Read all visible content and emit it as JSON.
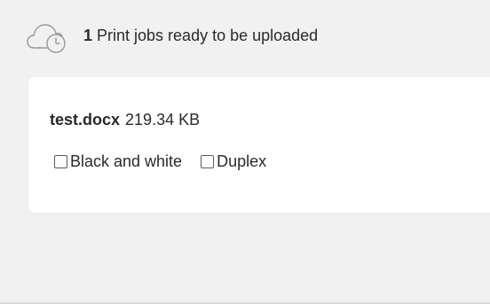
{
  "header": {
    "count": "1",
    "text": "Print jobs ready to be uploaded",
    "icon": "cloud-clock-icon"
  },
  "job": {
    "file_name": "test.docx",
    "file_size": "219.34 KB"
  },
  "options": {
    "black_and_white_label": "Black and white",
    "black_and_white_checked": false,
    "duplex_label": "Duplex",
    "duplex_checked": false
  },
  "colors": {
    "background": "#f1f1f1",
    "card": "#ffffff",
    "text": "#2a2a2a"
  }
}
